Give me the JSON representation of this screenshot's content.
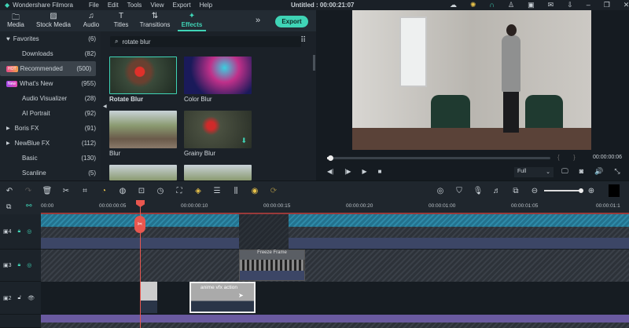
{
  "app": {
    "title": "Wondershare Filmora",
    "project": "Untitled : 00:00:21:07",
    "menu": [
      "File",
      "Edit",
      "Tools",
      "View",
      "Export",
      "Help"
    ],
    "window_icons": [
      "cloud-icon",
      "bulb-icon",
      "headset-icon",
      "user-icon",
      "save-icon",
      "mail-icon",
      "download-icon",
      "minimize-icon",
      "restore-icon",
      "close-icon"
    ]
  },
  "tabs": [
    {
      "label": "Media",
      "icon": "folder-icon"
    },
    {
      "label": "Stock Media",
      "icon": "image-icon"
    },
    {
      "label": "Audio",
      "icon": "music-icon"
    },
    {
      "label": "Titles",
      "icon": "text-icon"
    },
    {
      "label": "Transitions",
      "icon": "transition-icon"
    },
    {
      "label": "Effects",
      "icon": "effects-icon",
      "active": true
    }
  ],
  "export_label": "Export",
  "sidebar": [
    {
      "label": "Favorites",
      "count": "(6)",
      "icon": "heart-icon"
    },
    {
      "label": "Downloads",
      "count": "(82)"
    },
    {
      "label": "Recommended",
      "count": "(500)",
      "badge": "HOT",
      "active": true
    },
    {
      "label": "What's New",
      "count": "(955)",
      "badge": "New"
    },
    {
      "label": "Audio Visualizer",
      "count": "(28)"
    },
    {
      "label": "AI Portrait",
      "count": "(92)"
    },
    {
      "label": "Boris FX",
      "count": "(91)",
      "expand": true
    },
    {
      "label": "NewBlue FX",
      "count": "(112)",
      "expand": true
    },
    {
      "label": "Basic",
      "count": "(130)"
    },
    {
      "label": "Scanline",
      "count": "(5)"
    }
  ],
  "search": {
    "value": "rotate blur"
  },
  "effects": [
    {
      "label": "Rotate Blur",
      "selected": true
    },
    {
      "label": "Color Blur"
    },
    {
      "label": "Blur"
    },
    {
      "label": "Grainy Blur",
      "download": true
    }
  ],
  "player": {
    "time": "00:00:00:06",
    "quality": "Full",
    "progress": 0.01
  },
  "ruler": [
    "00:00",
    "00:00:00:05",
    "00:00:00:10",
    "00:00:00:15",
    "00:00:00:20",
    "00:00:01:00",
    "00:00:01:05",
    "00:00:01:1"
  ],
  "tracks": [
    {
      "num": "4"
    },
    {
      "num": "3",
      "clip": "Freeze Frame"
    },
    {
      "num": "2",
      "clip": "anime vfx action"
    }
  ],
  "colors": {
    "accent": "#3fd4b6",
    "playhead": "#e8574f",
    "track_clip": "#2e8aa8",
    "audio": "#6a5aa0"
  }
}
